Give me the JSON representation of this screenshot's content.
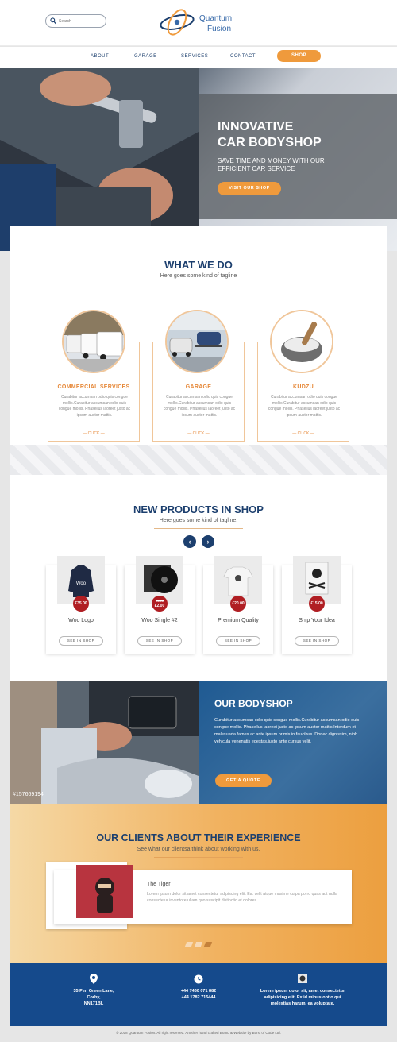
{
  "header": {
    "search_placeholder": "Search",
    "logo_line1": "Quantum",
    "logo_line2": "Fusion"
  },
  "nav": {
    "items": [
      "ABOUT",
      "GARAGE",
      "SERVICES",
      "CONTACT"
    ],
    "shop_label": "SHOP"
  },
  "hero": {
    "title_line1": "INNOVATIVE",
    "title_line2": "CAR BODYSHOP",
    "subtitle": "SAVE TIME AND MONEY WITH OUR EFFICIENT CAR SERVICE",
    "button": "VISIT OUR SHOP"
  },
  "what_we_do": {
    "title": "WHAT WE DO",
    "tagline": "Here goes some kind of tagline",
    "services": [
      {
        "title": "COMMERCIAL SERVICES",
        "text": "Curabitur accumsan odio quis congue mollis.Curabitur accumsan odio quis congue mollis. Phasellus laoreet justo ac ipsum auctor mattis.",
        "click": "— CLICK —"
      },
      {
        "title": "GARAGE",
        "text": "Curabitur accumsan odio quis congue mollis.Curabitur accumsan odio quis congue mollis. Phasellus laoreet justo ac ipsum auctor mattis.",
        "click": "— CLICK —"
      },
      {
        "title": "KUDZU",
        "text": "Curabitur accumsan odio quis congue mollis.Curabitur accumsan odio quis congue mollis. Phasellus laoreet justo ac ipsum auctor mattis.",
        "click": "— CLICK —"
      }
    ]
  },
  "products": {
    "title": "NEW PRODUCTS IN SHOP",
    "tagline": "Here goes some kind of tagline.",
    "items": [
      {
        "name": "Woo Logo",
        "price": "£35.00",
        "old_price": "",
        "button": "SEE IN SHOP"
      },
      {
        "name": "Woo Single #2",
        "price": "£2.00",
        "old_price": "£3.00",
        "button": "SEE IN SHOP"
      },
      {
        "name": "Premium Quality",
        "price": "£20.00",
        "old_price": "",
        "button": "SEE IN SHOP"
      },
      {
        "name": "Ship Your Idea",
        "price": "£15.00",
        "old_price": "",
        "button": "SEE IN SHOP"
      }
    ]
  },
  "bodyshop": {
    "title": "OUR BODYSHOP",
    "text": "Curabitur accumsan odio quis congue mollis.Curabitur accumsan odio quis congue mollis. Phasellus laoreet justo ac ipsum auctor mattis.Interdum et malesuada fames ac ante ipsum primis in faucibus. Donec dignissim, nibh vehicula venenatis egestas,justo ante cursus velit.",
    "button": "GET A QUOTE",
    "watermark_id": "#157669194"
  },
  "clients": {
    "title": "OUR CLIENTS ABOUT THEIR EXPERIENCE",
    "tagline": "See what our clientsa think about working with us.",
    "testimonial_name": "The Tiger",
    "testimonial_text": "Lorem ipsum dolor sit amet consectetur adipiscing elit. Ea. velit atque maxime culpa porro quas aut nulla consectetur inventore ullam quo suscipit distinctio et dolores."
  },
  "footer": {
    "address": [
      "35 Pen Green Lane,",
      "Corby,",
      "NN171BL"
    ],
    "phones": [
      "+44 7460 071 882",
      "+44 1782 715444"
    ],
    "about": [
      "Lorem ipsum dolor sit, amet consectetur",
      "adipisicing elit. Ex id minus optio qui",
      "molestias harum, ea voluptate."
    ],
    "copyright": "© 2018 Quantum Fusion. All right reserved. Another hand crafted Brand & Website by Burst of Code Ltd."
  },
  "colors": {
    "accent": "#ef9a3c",
    "navy": "#1c3f6e",
    "footer_blue": "#154a8c",
    "price_red": "#b01e23"
  }
}
